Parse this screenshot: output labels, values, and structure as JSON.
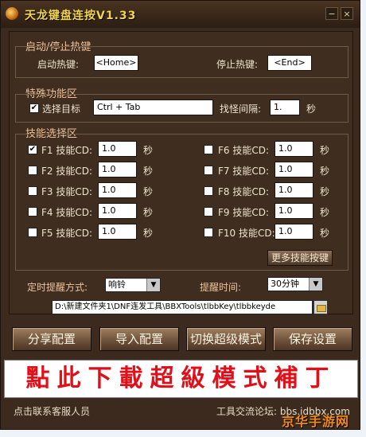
{
  "window": {
    "title": "天龙键盘连按V1.33",
    "minimize": "−",
    "close": "×"
  },
  "hotkeys": {
    "section_title": "启动/停止热键",
    "start_label": "启动热键:",
    "start_value": "<Home>",
    "stop_label": "停止热键:",
    "stop_value": "<End>"
  },
  "special": {
    "section_title": "特殊功能区",
    "select_target_label": "选择目标",
    "select_target_checked": true,
    "target_value": "Ctrl + Tab",
    "interval_label": "找怪间隔:",
    "interval_value": "1.",
    "interval_unit": "秒"
  },
  "skills": {
    "section_title": "技能选择区",
    "items": [
      {
        "key": "F1",
        "label": "F1 技能CD:",
        "value": "1.0",
        "unit": "秒",
        "checked": true
      },
      {
        "key": "F2",
        "label": "F2 技能CD:",
        "value": "1.0",
        "unit": "秒",
        "checked": false
      },
      {
        "key": "F3",
        "label": "F3 技能CD:",
        "value": "1.0",
        "unit": "秒",
        "checked": false
      },
      {
        "key": "F4",
        "label": "F4 技能CD:",
        "value": "1.0",
        "unit": "秒",
        "checked": false
      },
      {
        "key": "F5",
        "label": "F5 技能CD:",
        "value": "1.0",
        "unit": "秒",
        "checked": false
      },
      {
        "key": "F6",
        "label": "F6  技能CD:",
        "value": "1.0",
        "unit": "秒",
        "checked": false
      },
      {
        "key": "F7",
        "label": "F7  技能CD:",
        "value": "1.0",
        "unit": "秒",
        "checked": false
      },
      {
        "key": "F8",
        "label": "F8  技能CD:",
        "value": "1.0",
        "unit": "秒",
        "checked": false
      },
      {
        "key": "F9",
        "label": "F9  技能CD:",
        "value": "1.0",
        "unit": "秒",
        "checked": false
      },
      {
        "key": "F10",
        "label": "F10 技能CD:",
        "value": "1.0",
        "unit": "秒",
        "checked": false
      }
    ],
    "more_button": "更多技能按键"
  },
  "reminder": {
    "mode_label": "定时提醒方式:",
    "mode_value": "响铃",
    "time_label": "提醒时间:",
    "time_value": "30分钟"
  },
  "path_value": "D:\\新建文件夹1\\DNF连发工具\\BBXTools\\tlbbKey\\tlbbkeyde",
  "buttons": {
    "share": "分享配置",
    "import": "导入配置",
    "switch": "切换超级模式",
    "save": "保存设置"
  },
  "banner_text": "點此下載超級模式補丁",
  "status": {
    "left": "点击联系客服人员",
    "right": "工具交流论坛: bbs.idbbx.com"
  },
  "watermark": "京华手游网",
  "colors": {
    "accent": "#f2d54a",
    "banner_red": "#e0101a",
    "background": "#3b2a1d"
  }
}
